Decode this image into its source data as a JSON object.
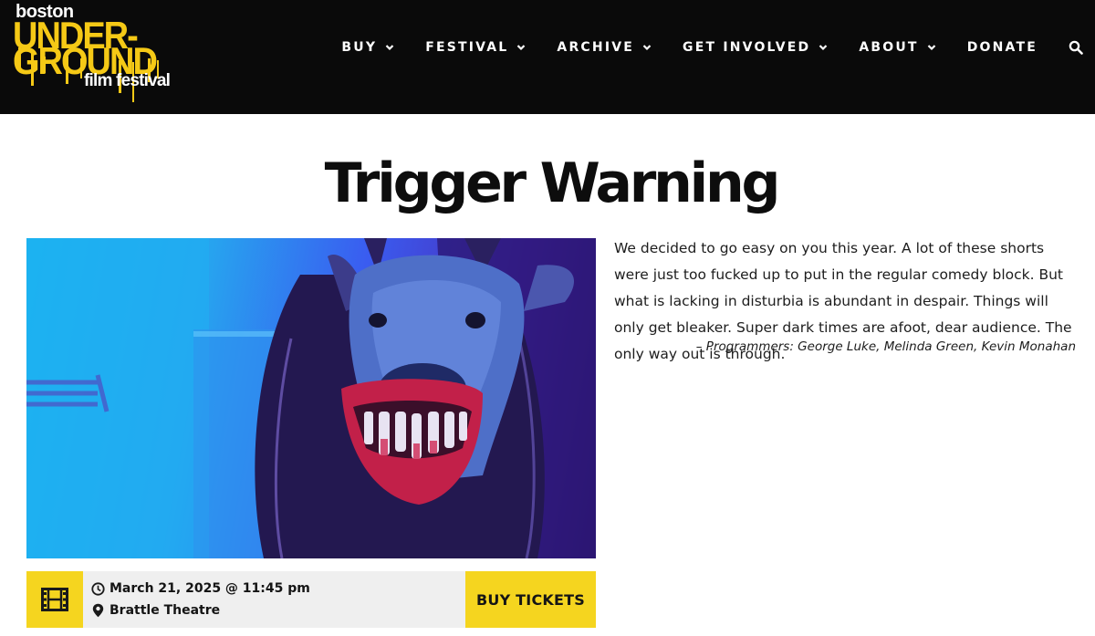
{
  "header": {
    "logo": {
      "line1": "boston",
      "line2": "UNDER-",
      "line3": "GROUND",
      "line4": "film festival"
    },
    "nav": [
      {
        "label": "BUY",
        "has_dropdown": true
      },
      {
        "label": "FESTIVAL",
        "has_dropdown": true
      },
      {
        "label": "ARCHIVE",
        "has_dropdown": true
      },
      {
        "label": "GET INVOLVED",
        "has_dropdown": true
      },
      {
        "label": "ABOUT",
        "has_dropdown": true
      },
      {
        "label": "DONATE",
        "has_dropdown": false
      }
    ],
    "search_icon": "search-icon"
  },
  "page": {
    "title": "Trigger Warning",
    "description": "We decided to go easy on you this year. A lot of these shorts were just too fucked up to put in the regular comedy block. But what is lacking in disturbia is abundant in despair. Things will only get bleaker. Super dark times are afoot, dear audience. The only way out is through.",
    "credit": "– Programmers: George Luke, Melinda Green, Kevin Monahan"
  },
  "event": {
    "date": "March 21, 2025 @ 11:45 pm",
    "venue": "Brattle Theatre",
    "buy_label": "BUY TICKETS",
    "icons": {
      "film": "film-icon",
      "clock": "clock-icon",
      "pin": "map-pin-icon"
    }
  },
  "colors": {
    "header_bg": "#0a0a0a",
    "brand_yellow": "#f5d51f",
    "info_bg": "#efefef"
  }
}
